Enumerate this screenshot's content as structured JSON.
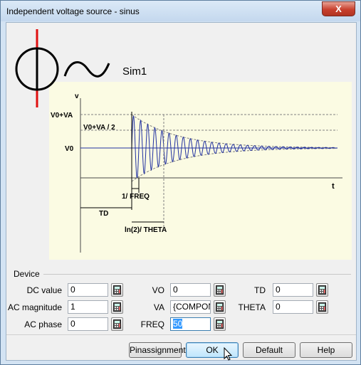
{
  "window": {
    "title": "Independent voltage source - sinus",
    "close_label": "X"
  },
  "diagram": {
    "sim_label": "Sim1",
    "axis_v": "v",
    "axis_t": "t",
    "level_top": "V0+VA",
    "level_mid": "V0+VA / 2",
    "level_base": "V0",
    "freq_label": "1/ FREQ",
    "td_label": "TD",
    "theta_label": "ln(2)/ THETA"
  },
  "device": {
    "group_label": "Device",
    "dc_value": {
      "label": "DC value",
      "value": "0"
    },
    "ac_magnitude": {
      "label": "AC magnitude",
      "value": "1"
    },
    "ac_phase": {
      "label": "AC phase",
      "value": "0"
    },
    "vo": {
      "label": "VO",
      "value": "0"
    },
    "va": {
      "label": "VA",
      "value": "{COMPON"
    },
    "freq": {
      "label": "FREQ",
      "value": "50"
    },
    "td": {
      "label": "TD",
      "value": "0"
    },
    "theta": {
      "label": "THETA",
      "value": "0"
    }
  },
  "buttons": {
    "pinassignment": "Pinassignment",
    "ok": "OK",
    "default": "Default",
    "help": "Help"
  }
}
